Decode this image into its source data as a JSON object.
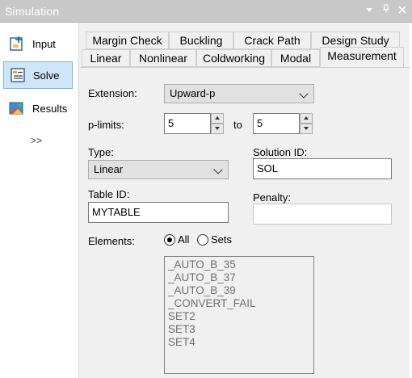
{
  "window": {
    "title": "Simulation",
    "controls": [
      "dropdown",
      "pin",
      "close"
    ]
  },
  "sidebar": {
    "items": [
      {
        "label": "Input",
        "icon": "input-icon",
        "active": false
      },
      {
        "label": "Solve",
        "icon": "solve-icon",
        "active": true
      },
      {
        "label": "Results",
        "icon": "results-icon",
        "active": false
      }
    ],
    "more_label": ">>"
  },
  "tabs": {
    "row1": [
      "Margin Check",
      "Buckling",
      "Crack Path",
      "Design Study"
    ],
    "row2": [
      "Linear",
      "Nonlinear",
      "Coldworking",
      "Modal",
      "Measurement"
    ],
    "active": "Measurement"
  },
  "form": {
    "extension_label": "Extension:",
    "extension_value": "Upward-p",
    "plimits_label": "p-limits:",
    "plimit_from": "5",
    "plimit_to_label": "to",
    "plimit_to": "5",
    "type_label": "Type:",
    "type_value": "Linear",
    "solution_id_label": "Solution ID:",
    "solution_id_value": "SOL",
    "table_id_label": "Table ID:",
    "table_id_value": "MYTABLE",
    "penalty_label": "Penalty:",
    "penalty_value": "",
    "elements_label": "Elements:",
    "elements_all_label": "All",
    "elements_sets_label": "Sets",
    "elements_selected": "All",
    "sets_list": [
      "_AUTO_B_35",
      "_AUTO_B_37",
      "_AUTO_B_39",
      "_CONVERT_FAIL",
      "SET2",
      "SET3",
      "SET4"
    ]
  }
}
